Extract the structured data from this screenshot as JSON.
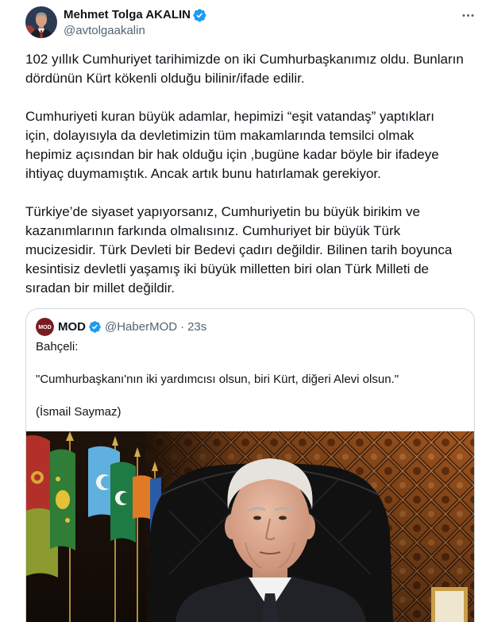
{
  "colors": {
    "text": "#0f1419",
    "secondary": "#536471",
    "accent": "#1d9bf0",
    "border": "#cfd9de",
    "background": "#ffffff"
  },
  "icons": {
    "verified": "verified-badge-icon",
    "more": "more-horizontal-icon"
  },
  "tweet": {
    "author": {
      "name": "Mehmet Tolga AKALIN",
      "handle": "@avtolgaakalin",
      "verified": true
    },
    "body": [
      [
        "102 yıllık Cumhuriyet tarihimizde on iki Cumhurbaşkanımız oldu. Bunların",
        "dördünün Kürt kökenli olduğu bilinir/ifade edilir."
      ],
      [
        "Cumhuriyeti kuran büyük adamlar, hepimizi “eşit vatandaş” yaptıkları",
        "için, dolayısıyla da devletimizin tüm makamlarında temsilci olmak",
        "hepimiz açısından bir hak olduğu için ,bugüne kadar böyle bir ifadeye",
        "ihtiyaç duymamıştık. Ancak artık bunu hatırlamak gerekiyor."
      ],
      [
        "Türkiye’de siyaset yapıyorsanız, Cumhuriyetin bu büyük birikim ve",
        "kazanımlarının farkında olmalısınız. Cumhuriyet bir büyük Türk",
        "mucizesidir. Türk Devleti bir Bedevi çadırı değildir. Bilinen tarih boyunca",
        "kesintisiz devletli yaşamış iki büyük milletten biri olan Türk Milleti de",
        "sıradan bir millet değildir."
      ]
    ],
    "quoted": {
      "author": {
        "name": "MOD",
        "handle": "@HaberMOD",
        "separator": "·",
        "time": "23s",
        "logo_text": "MOD",
        "verified": true
      },
      "lines": [
        "Bahçeli:",
        "\"Cumhurbaşkanı'nın iki yardımcısı olsun, biri Kürt, diğeri Alevi olsun.\"",
        "(İsmail Saymaz)"
      ]
    }
  }
}
